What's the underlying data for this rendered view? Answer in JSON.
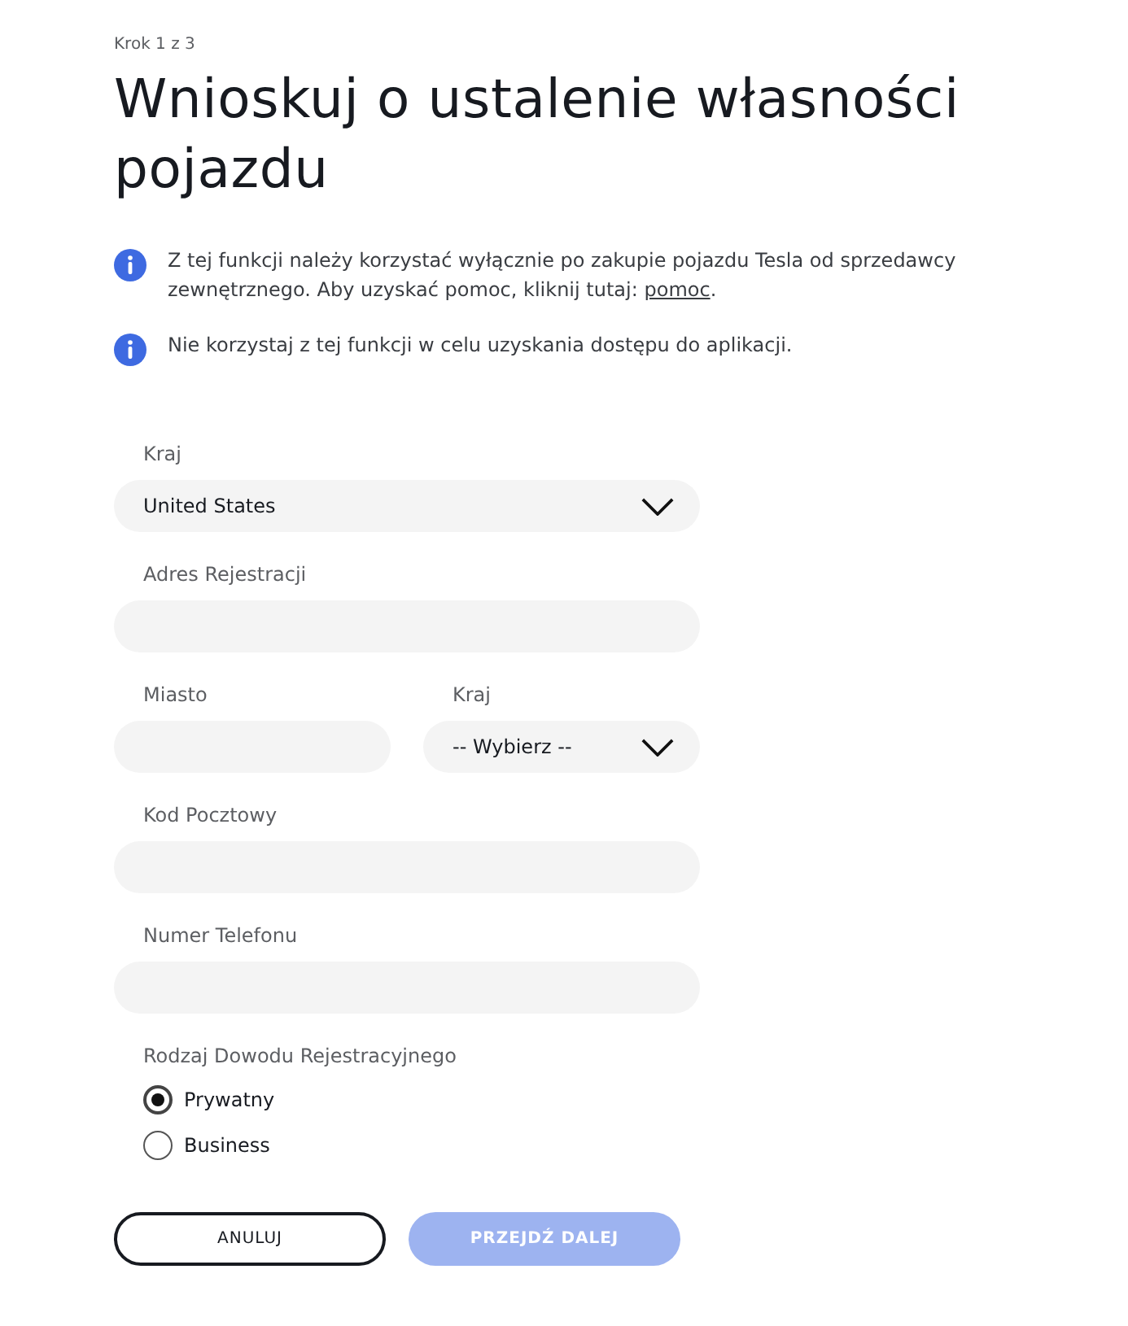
{
  "step": "Krok 1 z 3",
  "title": "Wnioskuj o ustalenie własności pojazdu",
  "notes": [
    {
      "text": "Z tej funkcji należy korzystać wyłącznie po zakupie pojazdu Tesla od sprzedawcy zewnętrznego. Aby uzyskać pomoc, kliknij tutaj: ",
      "link": "pomoc",
      "tail": "."
    },
    {
      "text": "Nie korzystaj z tej funkcji w celu uzyskania dostępu do aplikacji."
    }
  ],
  "form_rows": [
    [
      {
        "kind": "select",
        "label": "Kraj",
        "value": "United States"
      }
    ],
    [
      {
        "kind": "text",
        "label": "Adres Rejestracji"
      }
    ],
    [
      {
        "kind": "text",
        "label": "Miasto"
      },
      {
        "kind": "select",
        "label": "Kraj",
        "value": "-- Wybierz --"
      }
    ],
    [
      {
        "kind": "text",
        "label": "Kod Pocztowy"
      }
    ],
    [
      {
        "kind": "text",
        "label": "Numer Telefonu"
      }
    ]
  ],
  "registration_type": {
    "label": "Rodzaj Dowodu Rejestracyjnego",
    "options": [
      {
        "label": "Prywatny",
        "selected": true
      },
      {
        "label": "Business",
        "selected": false
      }
    ]
  },
  "buttons": [
    {
      "kind": "secondary",
      "label": "ANULUJ",
      "disabled": false
    },
    {
      "kind": "primary",
      "label": "PRZEJDŹ DALEJ",
      "disabled": true
    }
  ]
}
